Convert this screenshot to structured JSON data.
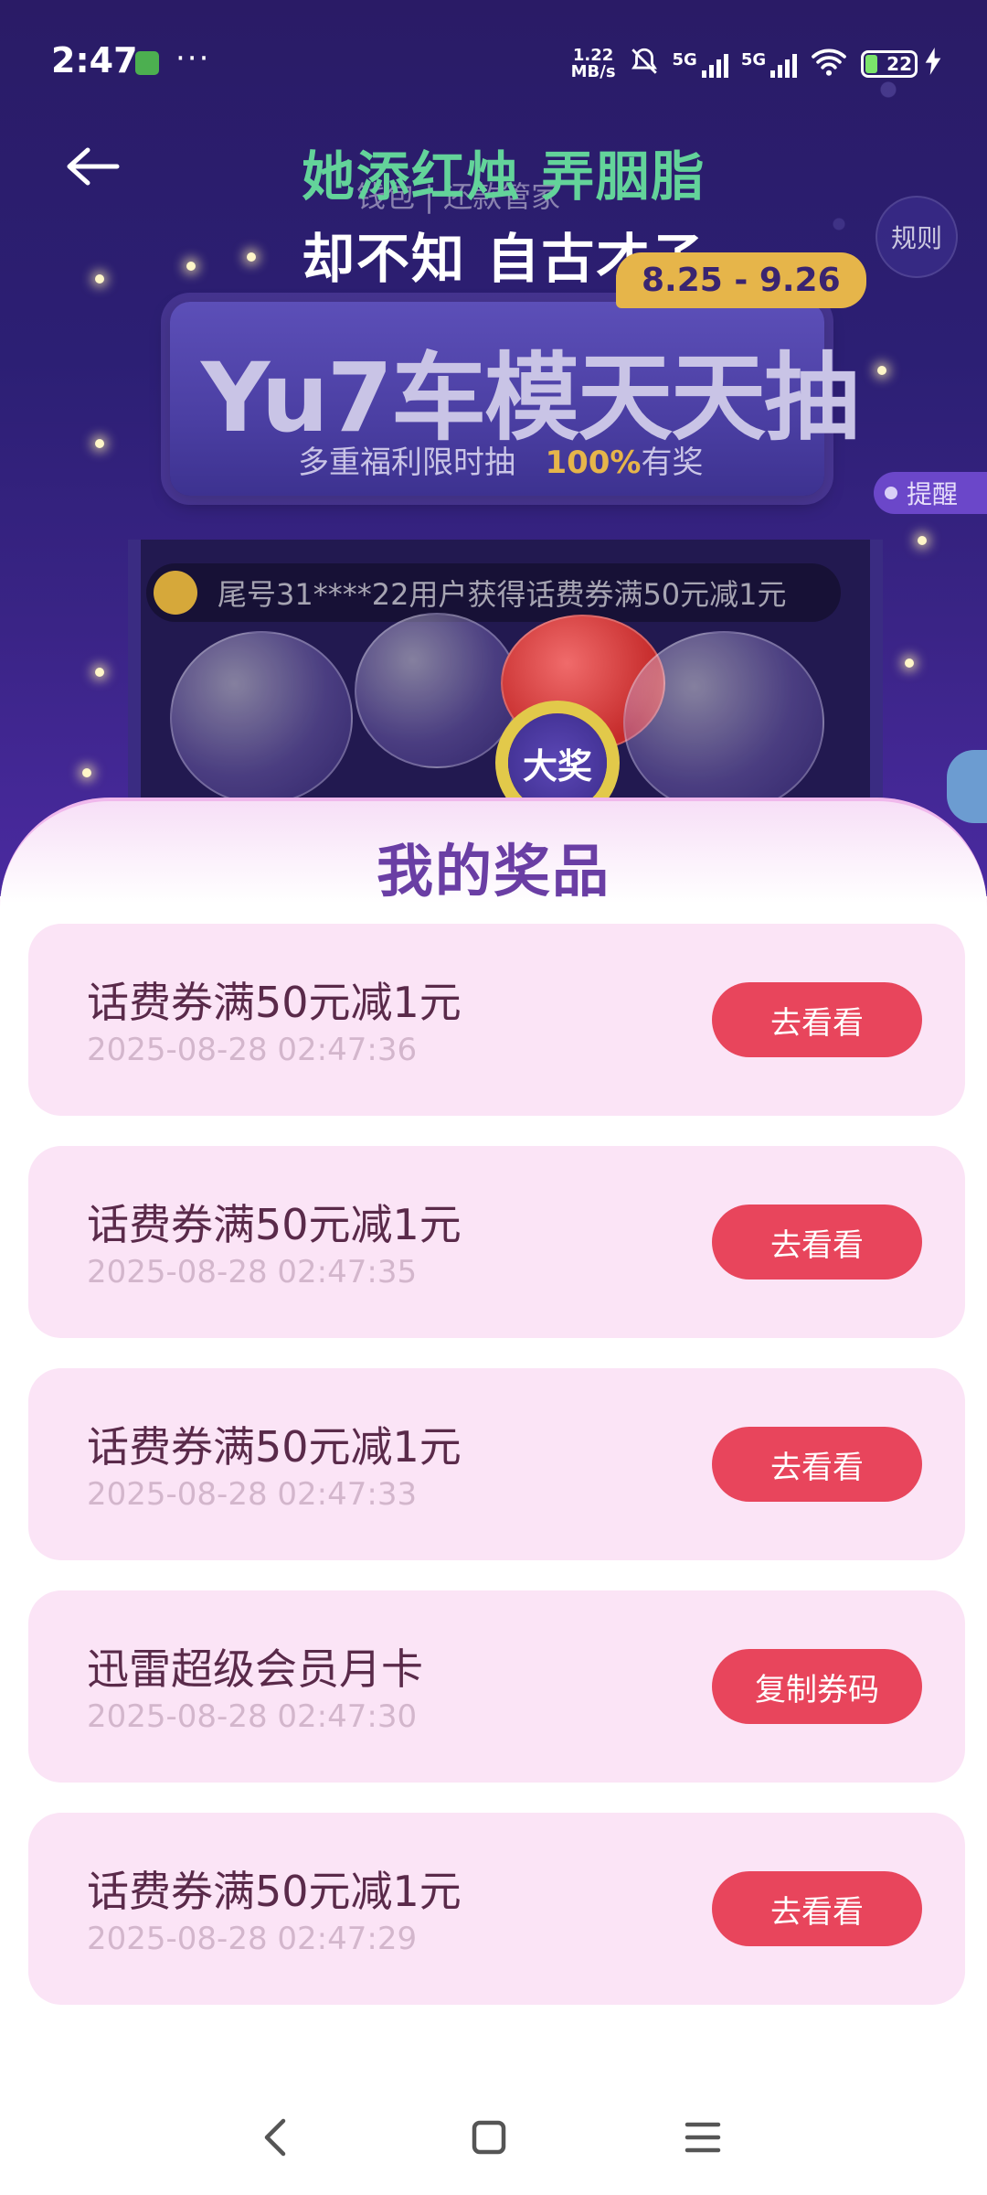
{
  "status_bar": {
    "time": "2:47",
    "more": "···",
    "net_speed_value": "1.22",
    "net_speed_unit": "MB/s",
    "sim1_label": "5G",
    "sim2_label": "5G",
    "battery_level": "22"
  },
  "header": {
    "title_line1": "她添红烛 弄胭脂",
    "title_line2": "却不知 自古才子",
    "crumb": "钱包 | 还款管家",
    "rules_label": "规则"
  },
  "banner": {
    "date_range": "8.25 - 9.26",
    "title": "Yu7车模天天抽",
    "subtitle_prefix": "多重福利限时抽",
    "subtitle_highlight": "100%",
    "subtitle_suffix": "有奖",
    "reminder_label": "提醒",
    "ticker_text": "尾号31****22用户获得话费券满50元减1元",
    "big_prize_label": "大奖"
  },
  "panel": {
    "title": "我的奖品",
    "prizes": [
      {
        "name": "话费券满50元减1元",
        "time": "2025-08-28 02:47:36",
        "action": "去看看"
      },
      {
        "name": "话费券满50元减1元",
        "time": "2025-08-28 02:47:35",
        "action": "去看看"
      },
      {
        "name": "话费券满50元减1元",
        "time": "2025-08-28 02:47:33",
        "action": "去看看"
      },
      {
        "name": "迅雷超级会员月卡",
        "time": "2025-08-28 02:47:30",
        "action": "复制券码"
      },
      {
        "name": "话费券满50元减1元",
        "time": "2025-08-28 02:47:29",
        "action": "去看看"
      }
    ]
  },
  "colors": {
    "accent_red": "#e8455c",
    "title_purple": "#6a3ea4",
    "card_pink": "#fbe4f6",
    "date_badge": "#e6b54a"
  },
  "icons": {
    "back": "arrow-left-icon",
    "mute": "bell-off-icon",
    "wifi": "wifi-icon",
    "charging": "lightning-icon",
    "nav_back": "chevron-left-icon",
    "nav_home": "square-icon",
    "nav_menu": "menu-icon"
  }
}
